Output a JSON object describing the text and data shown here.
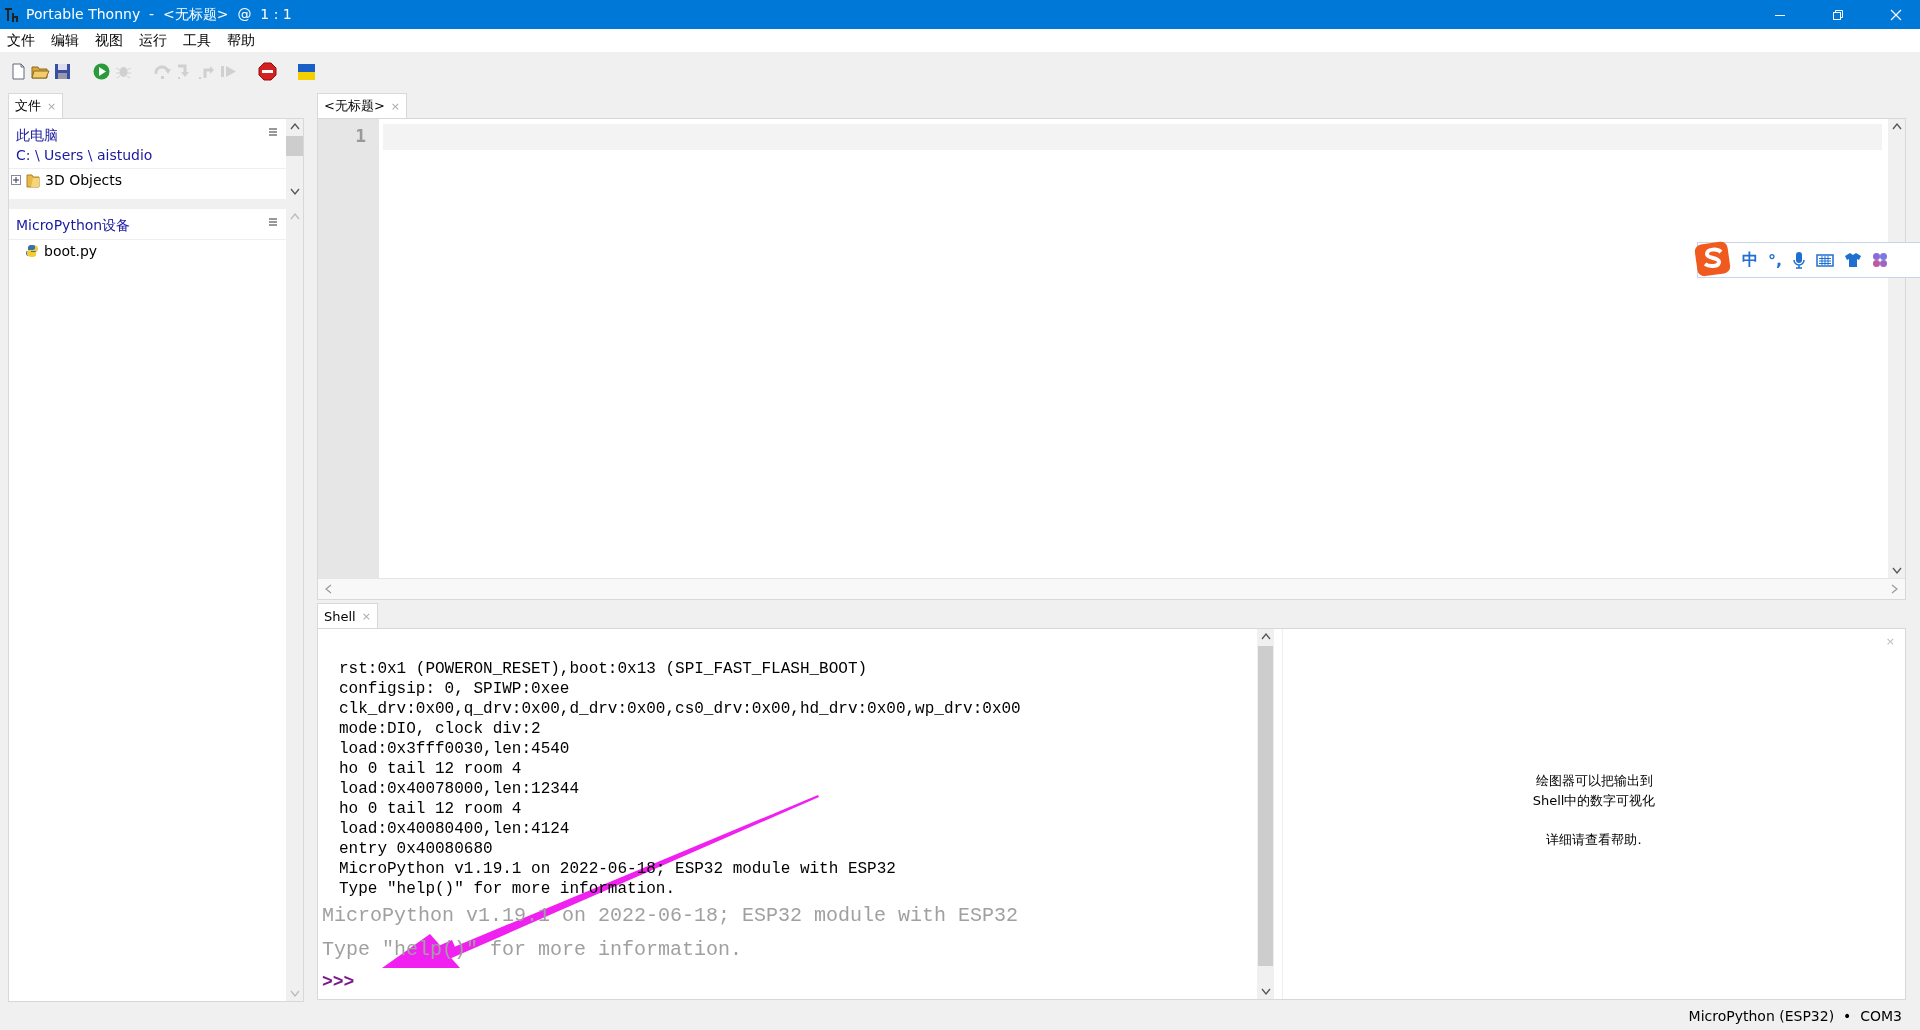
{
  "window": {
    "title": "Portable Thonny  -  <无标题>  @  1 : 1"
  },
  "menu": [
    "文件",
    "编辑",
    "视图",
    "运行",
    "工具",
    "帮助"
  ],
  "toolbar": [
    {
      "kind": "new",
      "disabled": false
    },
    {
      "kind": "open",
      "disabled": false
    },
    {
      "kind": "save",
      "disabled": false
    },
    {
      "kind": "run",
      "disabled": false
    },
    {
      "kind": "debug",
      "disabled": true
    },
    {
      "kind": "step_over",
      "disabled": true
    },
    {
      "kind": "step_into",
      "disabled": true
    },
    {
      "kind": "step_out",
      "disabled": true
    },
    {
      "kind": "resume",
      "disabled": true
    },
    {
      "kind": "stop",
      "disabled": false
    },
    {
      "kind": "flag",
      "disabled": false
    }
  ],
  "files_panel": {
    "tab": {
      "label": "文件",
      "close": "×",
      "selected": true
    },
    "computer": {
      "title": "此电脑",
      "path": "C: \\ Users \\ aistudio",
      "items": [
        {
          "label": "3D Objects",
          "kind": "folder",
          "expanded": false
        }
      ]
    },
    "device": {
      "title": "MicroPython设备",
      "items": [
        {
          "label": "boot.py",
          "kind": "python"
        }
      ]
    }
  },
  "editor": {
    "tab": {
      "label": "<无标题>",
      "close": "×",
      "selected": true
    },
    "line_numbers": [
      "1"
    ]
  },
  "shell": {
    "tab": {
      "label": "Shell",
      "close": "×",
      "selected": true
    },
    "lines": [
      {
        "kind": "blank"
      },
      {
        "kind": "blank"
      },
      {
        "kind": "output",
        "text": "rst:0x1 (POWERON_RESET),boot:0x13 (SPI_FAST_FLASH_BOOT)"
      },
      {
        "kind": "output",
        "text": "configsip: 0, SPIWP:0xee"
      },
      {
        "kind": "output",
        "text": "clk_drv:0x00,q_drv:0x00,d_drv:0x00,cs0_drv:0x00,hd_drv:0x00,wp_drv:0x00"
      },
      {
        "kind": "output",
        "text": "mode:DIO, clock div:2"
      },
      {
        "kind": "output",
        "text": "load:0x3fff0030,len:4540"
      },
      {
        "kind": "output",
        "text": "ho 0 tail 12 room 4"
      },
      {
        "kind": "output",
        "text": "load:0x40078000,len:12344"
      },
      {
        "kind": "output",
        "text": "ho 0 tail 12 room 4"
      },
      {
        "kind": "output",
        "text": "load:0x40080400,len:4124"
      },
      {
        "kind": "output",
        "text": "entry 0x40080680"
      },
      {
        "kind": "output",
        "text": "MicroPython v1.19.1 on 2022-06-18; ESP32 module with ESP32"
      },
      {
        "kind": "output",
        "text": "Type \"help()\" for more information."
      },
      {
        "kind": "banner",
        "text": "MicroPython v1.19.1 on 2022-06-18; ESP32 module with ESP32"
      },
      {
        "kind": "banner",
        "text": "Type \"help()\" for more information."
      }
    ],
    "prompt": ">>>"
  },
  "plotter": {
    "message": "绘图器可以把输出到\nShell中的数字可视化",
    "hint": "详细请查看帮助.",
    "close": "×"
  },
  "ime_toolbar": {
    "mode": "中",
    "punctuation": "°,"
  },
  "status_bar": {
    "text": "MicroPython (ESP32)  •  COM3"
  }
}
